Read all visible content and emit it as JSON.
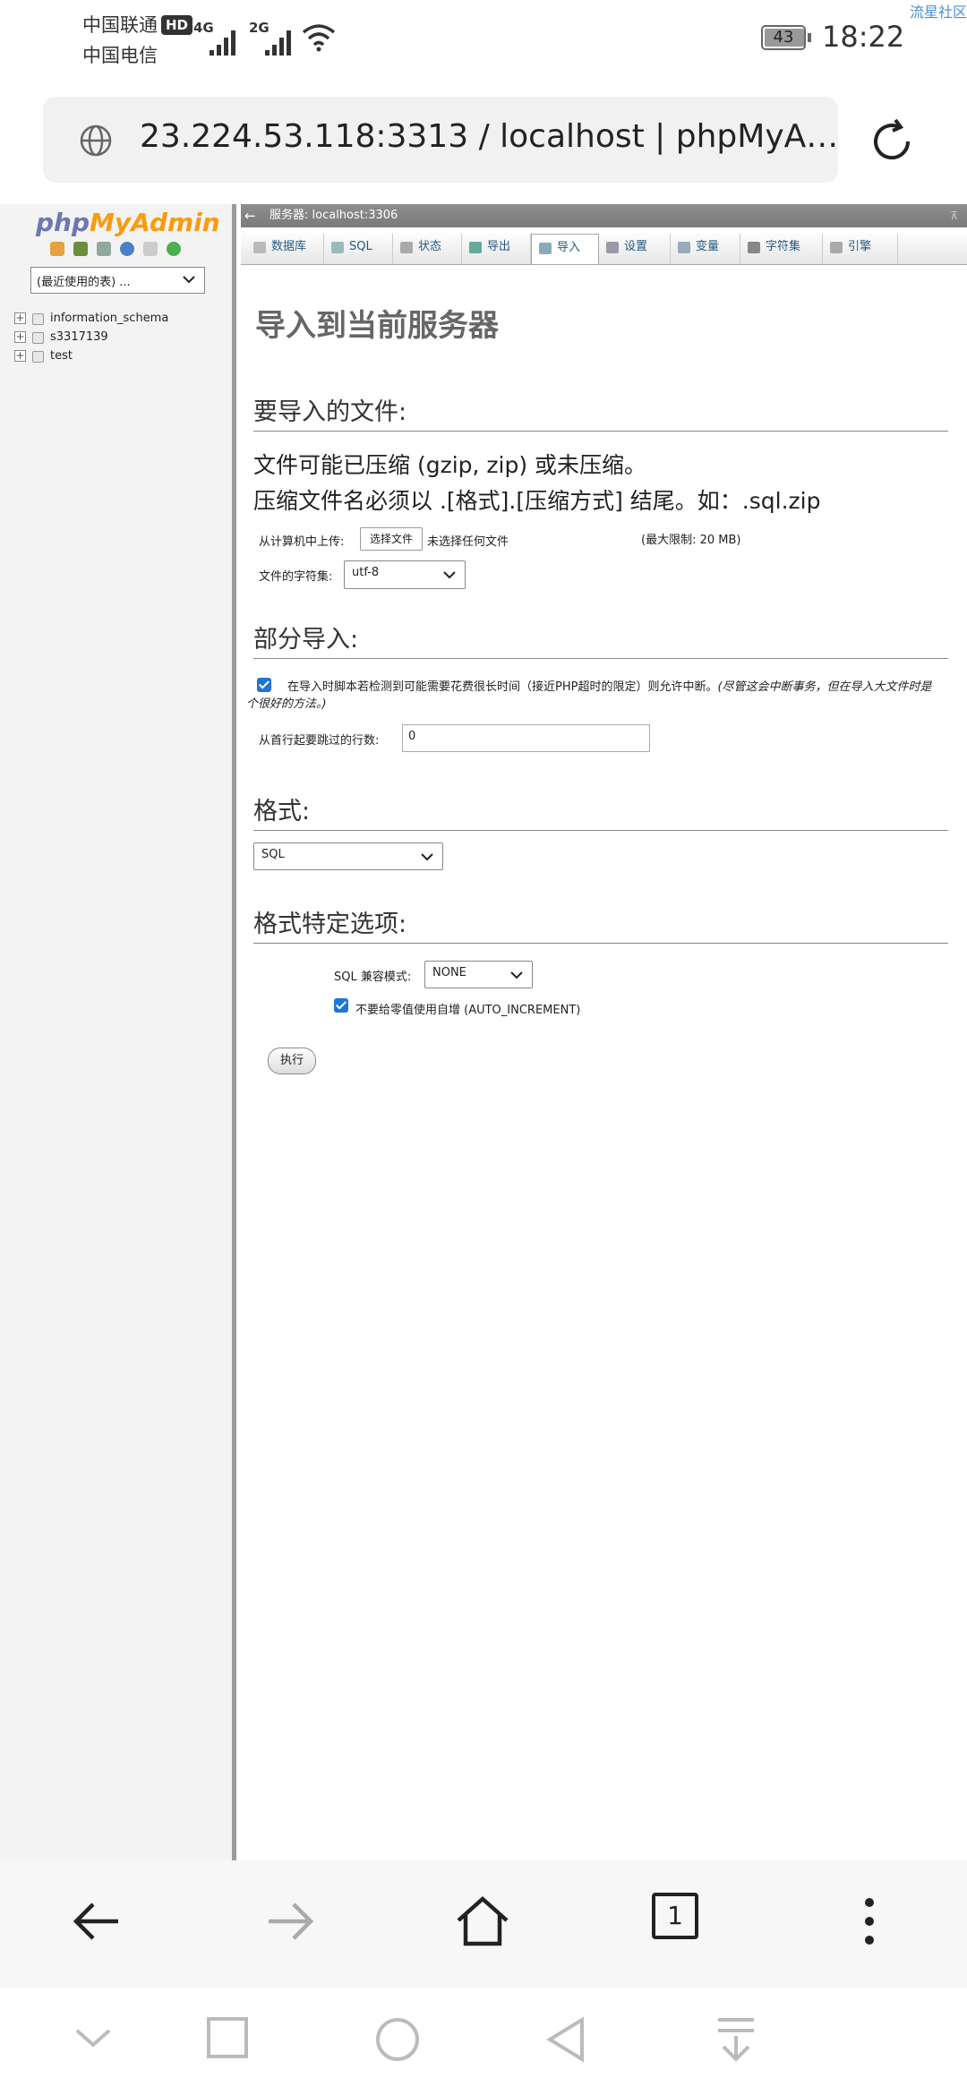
{
  "status_bar": {
    "carrier1": "中国联通",
    "hd": "HD",
    "carrier2": "中国电信",
    "net1": "4G",
    "net2": "2G",
    "battery": "43",
    "time": "18:22",
    "watermark": "流星社区"
  },
  "browser": {
    "address": "23.224.53.118:3313 / localhost | phpMyA…",
    "tab_count": "1"
  },
  "pma": {
    "logo_php": "php",
    "logo_myadmin": "MyAdmin",
    "recent_tables": "(最近使用的表) ...",
    "databases": [
      "information_schema",
      "s3317139",
      "test"
    ],
    "server_label": "服务器: localhost:3306",
    "tabs": [
      "数据库",
      "SQL",
      "状态",
      "导出",
      "导入",
      "设置",
      "变量",
      "字符集",
      "引擎"
    ],
    "active_tab": "导入",
    "page_title": "导入到当前服务器",
    "section_file": "要导入的文件:",
    "compress_line1": "文件可能已压缩 (gzip, zip) 或未压缩。",
    "compress_line2": "压缩文件名必须以 .[格式].[压缩方式] 结尾。如：.sql.zip",
    "upload_label": "从计算机中上传:",
    "choose_file": "选择文件",
    "no_file": "未选择任何文件",
    "max_limit": "(最大限制: 20 MB)",
    "charset_label": "文件的字符集:",
    "charset_value": "utf-8",
    "section_partial": "部分导入:",
    "partial_text": "在导入时脚本若检测到可能需要花费很长时间（接近PHP超时的限定）则允许中断。",
    "partial_note_line1": "(尽管这会中断事务，但在导入大文件时是",
    "partial_note_line2": "个很好的方法。)",
    "skip_label": "从首行起要跳过的行数:",
    "skip_value": "0",
    "section_format": "格式:",
    "format_value": "SQL",
    "section_format_opts": "格式特定选项:",
    "compat_label": "SQL 兼容模式:",
    "compat_value": "NONE",
    "auto_inc_label": "不要给零值使用自增 (AUTO_INCREMENT)",
    "go_button": "执行"
  }
}
